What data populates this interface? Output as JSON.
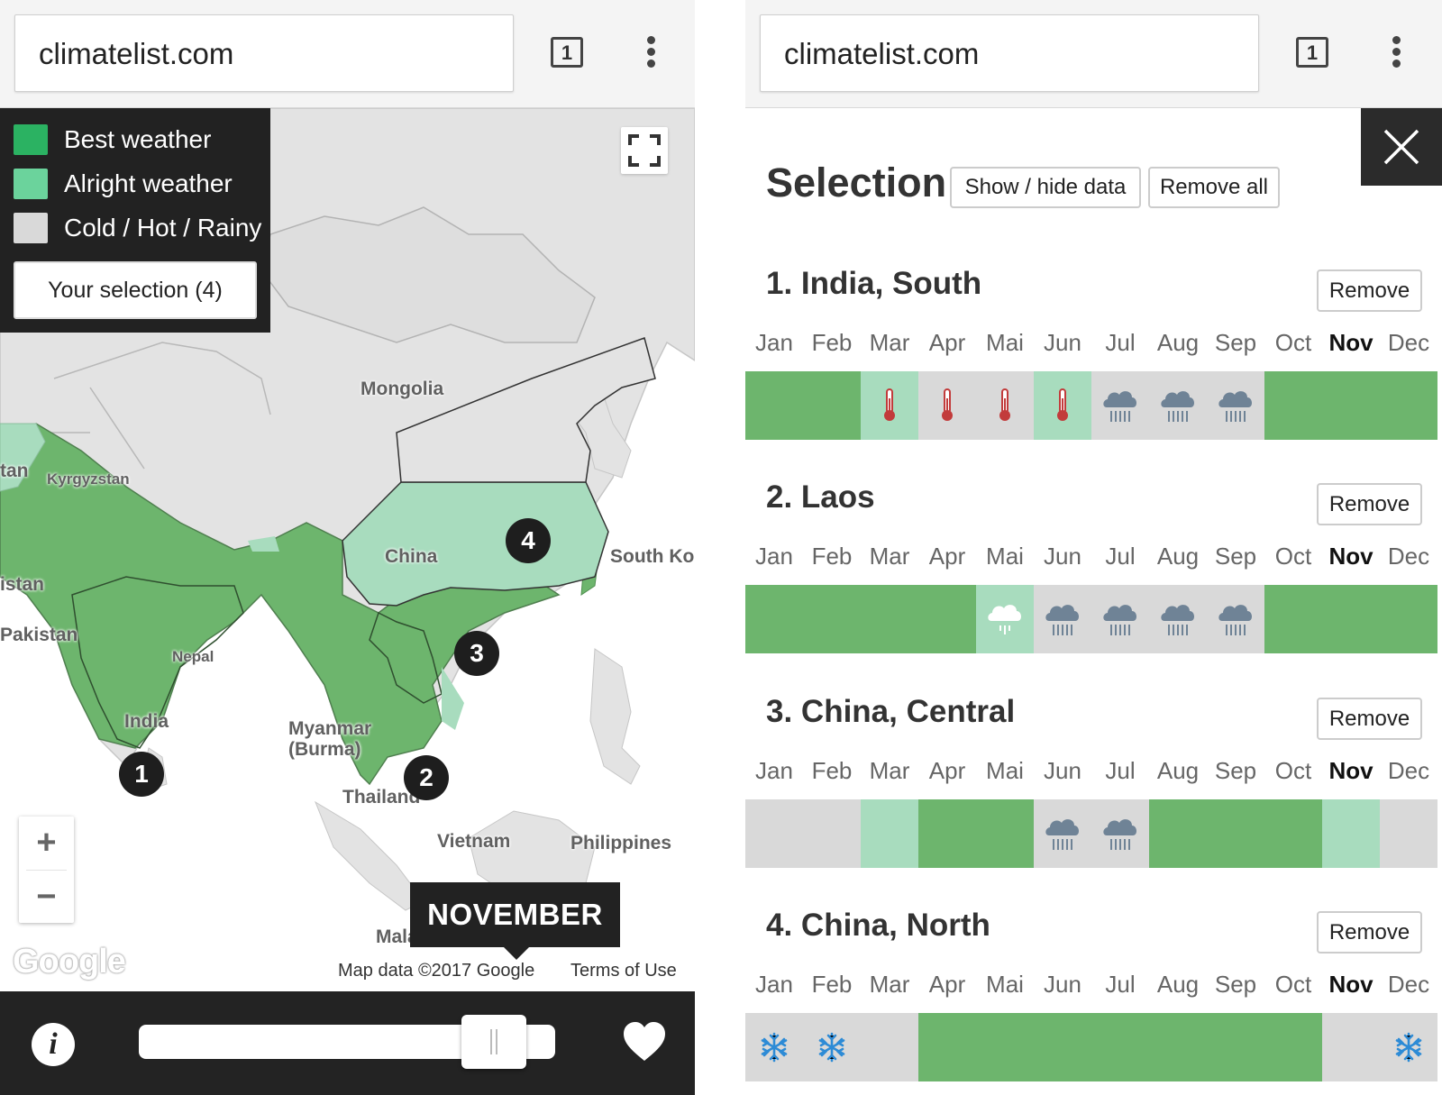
{
  "browser": {
    "url": "climatelist.com",
    "tab_count": "1"
  },
  "colors": {
    "best": "#6db56d",
    "alright": "#a8dcbe",
    "poor": "#d9d9d9",
    "legend_best": "#2bb262",
    "legend_alright": "#6bd39c",
    "legend_poor": "#d9d9d9",
    "chrome": "#f4f4f4",
    "dark": "#232323"
  },
  "legend": {
    "items": [
      {
        "label": "Best weather",
        "color_key": "legend_best"
      },
      {
        "label": "Alright weather",
        "color_key": "legend_alright"
      },
      {
        "label": "Cold / Hot / Rainy",
        "color_key": "legend_poor"
      }
    ],
    "selection_button": "Your selection (4)"
  },
  "map": {
    "country_labels": [
      {
        "text": "Mongolia"
      },
      {
        "text": "Kyrgyzstan"
      },
      {
        "text": "China"
      },
      {
        "text": "South Ko"
      },
      {
        "text": "Pakistan"
      },
      {
        "text": "Nepal"
      },
      {
        "text": "India"
      },
      {
        "text": "Myanmar (Burma)"
      },
      {
        "text": "Thailand"
      },
      {
        "text": "Vietnam"
      },
      {
        "text": "Philippines"
      },
      {
        "text": "Malaysia"
      },
      {
        "text": "istan"
      },
      {
        "text": "tan"
      }
    ],
    "pins": [
      "1",
      "2",
      "3",
      "4"
    ],
    "month_tooltip": "NOVEMBER",
    "zoom_in": "+",
    "zoom_out": "−",
    "google_logo": "Google",
    "attribution": "Map data ©2017 Google",
    "terms": "Terms of Use",
    "month_slider_value": 11,
    "month_slider_max": 12
  },
  "panel": {
    "title": "Selection",
    "show_hide_label": "Show / hide data",
    "remove_all_label": "Remove all",
    "remove_label": "Remove",
    "months": [
      "Jan",
      "Feb",
      "Mar",
      "Apr",
      "Mai",
      "Jun",
      "Jul",
      "Aug",
      "Sep",
      "Oct",
      "Nov",
      "Dec"
    ],
    "active_month": 10,
    "locations": [
      {
        "title": "1. India, South",
        "cells": [
          {
            "rating": "best"
          },
          {
            "rating": "best"
          },
          {
            "rating": "alright",
            "icon": "thermometer-icon"
          },
          {
            "rating": "poor",
            "icon": "thermometer-icon"
          },
          {
            "rating": "poor",
            "icon": "thermometer-icon"
          },
          {
            "rating": "alright",
            "icon": "thermometer-icon"
          },
          {
            "rating": "poor",
            "icon": "rain-cloud-icon"
          },
          {
            "rating": "poor",
            "icon": "rain-cloud-icon"
          },
          {
            "rating": "poor",
            "icon": "rain-cloud-icon"
          },
          {
            "rating": "best"
          },
          {
            "rating": "best"
          },
          {
            "rating": "best"
          }
        ]
      },
      {
        "title": "2. Laos",
        "cells": [
          {
            "rating": "best"
          },
          {
            "rating": "best"
          },
          {
            "rating": "best"
          },
          {
            "rating": "best"
          },
          {
            "rating": "alright",
            "icon": "light-rain-cloud-icon"
          },
          {
            "rating": "poor",
            "icon": "rain-cloud-icon"
          },
          {
            "rating": "poor",
            "icon": "rain-cloud-icon"
          },
          {
            "rating": "poor",
            "icon": "rain-cloud-icon"
          },
          {
            "rating": "poor",
            "icon": "rain-cloud-icon"
          },
          {
            "rating": "best"
          },
          {
            "rating": "best"
          },
          {
            "rating": "best"
          }
        ]
      },
      {
        "title": "3. China, Central",
        "cells": [
          {
            "rating": "poor"
          },
          {
            "rating": "poor"
          },
          {
            "rating": "alright"
          },
          {
            "rating": "best"
          },
          {
            "rating": "best"
          },
          {
            "rating": "poor",
            "icon": "rain-cloud-icon"
          },
          {
            "rating": "poor",
            "icon": "rain-cloud-icon"
          },
          {
            "rating": "best"
          },
          {
            "rating": "best"
          },
          {
            "rating": "best"
          },
          {
            "rating": "alright"
          },
          {
            "rating": "poor"
          }
        ]
      },
      {
        "title": "4. China, North",
        "cells": [
          {
            "rating": "poor",
            "icon": "snowflake-icon"
          },
          {
            "rating": "poor",
            "icon": "snowflake-icon"
          },
          {
            "rating": "poor"
          },
          {
            "rating": "best"
          },
          {
            "rating": "best"
          },
          {
            "rating": "best"
          },
          {
            "rating": "best"
          },
          {
            "rating": "best"
          },
          {
            "rating": "best"
          },
          {
            "rating": "best"
          },
          {
            "rating": "poor"
          },
          {
            "rating": "poor",
            "icon": "snowflake-icon"
          }
        ]
      }
    ]
  }
}
